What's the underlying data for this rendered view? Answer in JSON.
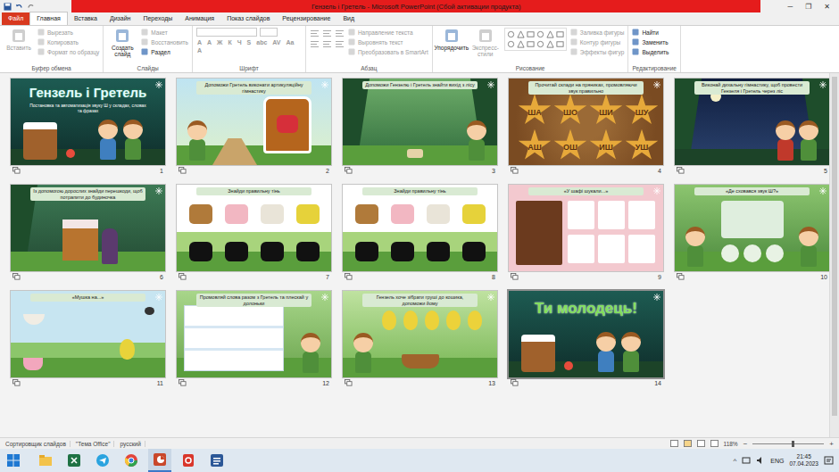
{
  "window": {
    "title": "Гензель і Гретель - Microsoft PowerPoint (Сбой активации продукта)",
    "controls": [
      "─",
      "❐",
      "✕"
    ]
  },
  "tabs": [
    {
      "label": "Файл",
      "kind": "file",
      "selected": false
    },
    {
      "label": "Главная",
      "kind": "tab",
      "selected": true
    },
    {
      "label": "Вставка",
      "kind": "tab",
      "selected": false
    },
    {
      "label": "Дизайн",
      "kind": "tab",
      "selected": false
    },
    {
      "label": "Переходы",
      "kind": "tab",
      "selected": false
    },
    {
      "label": "Анимация",
      "kind": "tab",
      "selected": false
    },
    {
      "label": "Показ слайдов",
      "kind": "tab",
      "selected": false
    },
    {
      "label": "Рецензирование",
      "kind": "tab",
      "selected": false
    },
    {
      "label": "Вид",
      "kind": "tab",
      "selected": false
    }
  ],
  "ribbon": {
    "groups": [
      {
        "label": "Буфер обмена",
        "large": [
          {
            "label": "Вставить",
            "disabled": true
          }
        ],
        "small": [
          {
            "label": "Вырезать",
            "disabled": true
          },
          {
            "label": "Копировать",
            "disabled": true
          },
          {
            "label": "Формат по образцу",
            "disabled": true
          }
        ],
        "buttons": []
      },
      {
        "label": "Слайды",
        "large": [
          {
            "label": "Создать слайд",
            "disabled": false
          }
        ],
        "small": [
          {
            "label": "Макет",
            "disabled": true
          },
          {
            "label": "Восстановить",
            "disabled": true
          },
          {
            "label": "Раздел",
            "disabled": false
          }
        ],
        "buttons": []
      },
      {
        "label": "Шрифт",
        "large": [],
        "small": [],
        "buttons": [
          {
            "label": "A",
            "disabled": true
          },
          {
            "label": "A",
            "disabled": true
          },
          {
            "label": "Ж",
            "disabled": true
          },
          {
            "label": "К",
            "disabled": true
          },
          {
            "label": "Ч",
            "disabled": true
          },
          {
            "label": "S",
            "disabled": true
          },
          {
            "label": "abc",
            "disabled": true
          },
          {
            "label": "AV",
            "disabled": true
          },
          {
            "label": "Aa",
            "disabled": true
          },
          {
            "label": "A",
            "disabled": true
          }
        ]
      },
      {
        "label": "Абзац",
        "large": [],
        "small": [
          {
            "label": "Направление текста",
            "disabled": true
          },
          {
            "label": "Выровнять текст",
            "disabled": true
          },
          {
            "label": "Преобразовать в SmartArt",
            "disabled": true
          }
        ],
        "buttons": []
      },
      {
        "label": "Рисование",
        "large": [
          {
            "label": "Упорядочить",
            "disabled": false
          },
          {
            "label": "Экспресс-стили",
            "disabled": true
          }
        ],
        "small": [
          {
            "label": "Заливка фигуры",
            "disabled": true
          },
          {
            "label": "Контур фигуры",
            "disabled": true
          },
          {
            "label": "Эффекты фигур",
            "disabled": true
          }
        ],
        "buttons": []
      },
      {
        "label": "Редактирование",
        "large": [],
        "small": [
          {
            "label": "Найти",
            "disabled": false
          },
          {
            "label": "Заменить",
            "disabled": false
          },
          {
            "label": "Выделить",
            "disabled": false
          }
        ],
        "buttons": []
      }
    ]
  },
  "slides": [
    {
      "number": "1",
      "kind": "title",
      "heading": "",
      "big": "Гензель і Гретель",
      "subtitle": "Постановка та автоматизація звуку Ш у складах, словах та фразах",
      "syllables": [],
      "selected": false
    },
    {
      "number": "2",
      "kind": "meadow",
      "heading": "Допоможи Гретель виконати артикуляційну гімнастику",
      "big": "",
      "subtitle": "",
      "syllables": [],
      "selected": false
    },
    {
      "number": "3",
      "kind": "forest",
      "heading": "Допоможи Гензелю і Гретель знайти вихід з лісу",
      "big": "",
      "subtitle": "",
      "syllables": [],
      "selected": false
    },
    {
      "number": "4",
      "kind": "stars",
      "heading": "Прочитай склади на пряниках, промовляючи звук правильно",
      "big": "",
      "subtitle": "",
      "syllables": [
        "ША",
        "ШО",
        "ШИ",
        "ШУ",
        "АШ",
        "ОШ",
        "ИШ",
        "УШ"
      ],
      "selected": false
    },
    {
      "number": "5",
      "kind": "night",
      "heading": "Виконай дихальну гімнастику, щоб провести Гензеля і Гретель через ліс",
      "big": "",
      "subtitle": "",
      "syllables": [],
      "selected": false
    },
    {
      "number": "6",
      "kind": "cottage",
      "heading": "Із допомогою дорослих знайди перешкоди, щоб потрапити до будиночка",
      "big": "",
      "subtitle": "",
      "syllables": [],
      "selected": false
    },
    {
      "number": "7",
      "kind": "shadows",
      "heading": "Знайди правильну тінь",
      "big": "",
      "subtitle": "",
      "syllables": [],
      "selected": false
    },
    {
      "number": "8",
      "kind": "shadows",
      "heading": "Знайди правильну тінь",
      "big": "",
      "subtitle": "",
      "syllables": [],
      "selected": false
    },
    {
      "number": "9",
      "kind": "wardrobe",
      "heading": "«У шафі шукали...»",
      "big": "",
      "subtitle": "",
      "syllables": [],
      "selected": false
    },
    {
      "number": "10",
      "kind": "circles",
      "heading": "«Де сховався звук Ш?»",
      "big": "",
      "subtitle": "",
      "syllables": [],
      "selected": false
    },
    {
      "number": "11",
      "kind": "fly",
      "heading": "«Мушка на...»",
      "big": "",
      "subtitle": "",
      "syllables": [],
      "selected": false
    },
    {
      "number": "12",
      "kind": "rows",
      "heading": "Промовляй слова разом з Гретель та плескай у долоньки",
      "big": "",
      "subtitle": "",
      "syllables": [],
      "selected": false
    },
    {
      "number": "13",
      "kind": "pears",
      "heading": "Гензель хоче зібрати груші до кошика, допоможи йому",
      "big": "",
      "subtitle": "",
      "syllables": [],
      "selected": false
    },
    {
      "number": "14",
      "kind": "end",
      "heading": "",
      "big": "Ти молодець!",
      "subtitle": "",
      "syllables": [],
      "selected": true
    }
  ],
  "status_bar": {
    "items": [
      "Сортировщик слайдов",
      "\"Тема Office\"",
      "русский"
    ],
    "zoom": "118%",
    "zoom_level": 0.55,
    "minus": "−",
    "plus": "+"
  },
  "taskbar": {
    "apps": [
      {
        "kind": "explorer",
        "selected": false
      },
      {
        "kind": "excel",
        "selected": false
      },
      {
        "kind": "telegram",
        "selected": false
      },
      {
        "kind": "chrome",
        "selected": false
      },
      {
        "kind": "powerpoint",
        "selected": true
      },
      {
        "kind": "reader",
        "selected": false
      },
      {
        "kind": "word",
        "selected": false
      }
    ],
    "tray_arrow": "^",
    "language": "ENG",
    "time": "21:45",
    "date": "07.04.2023"
  }
}
